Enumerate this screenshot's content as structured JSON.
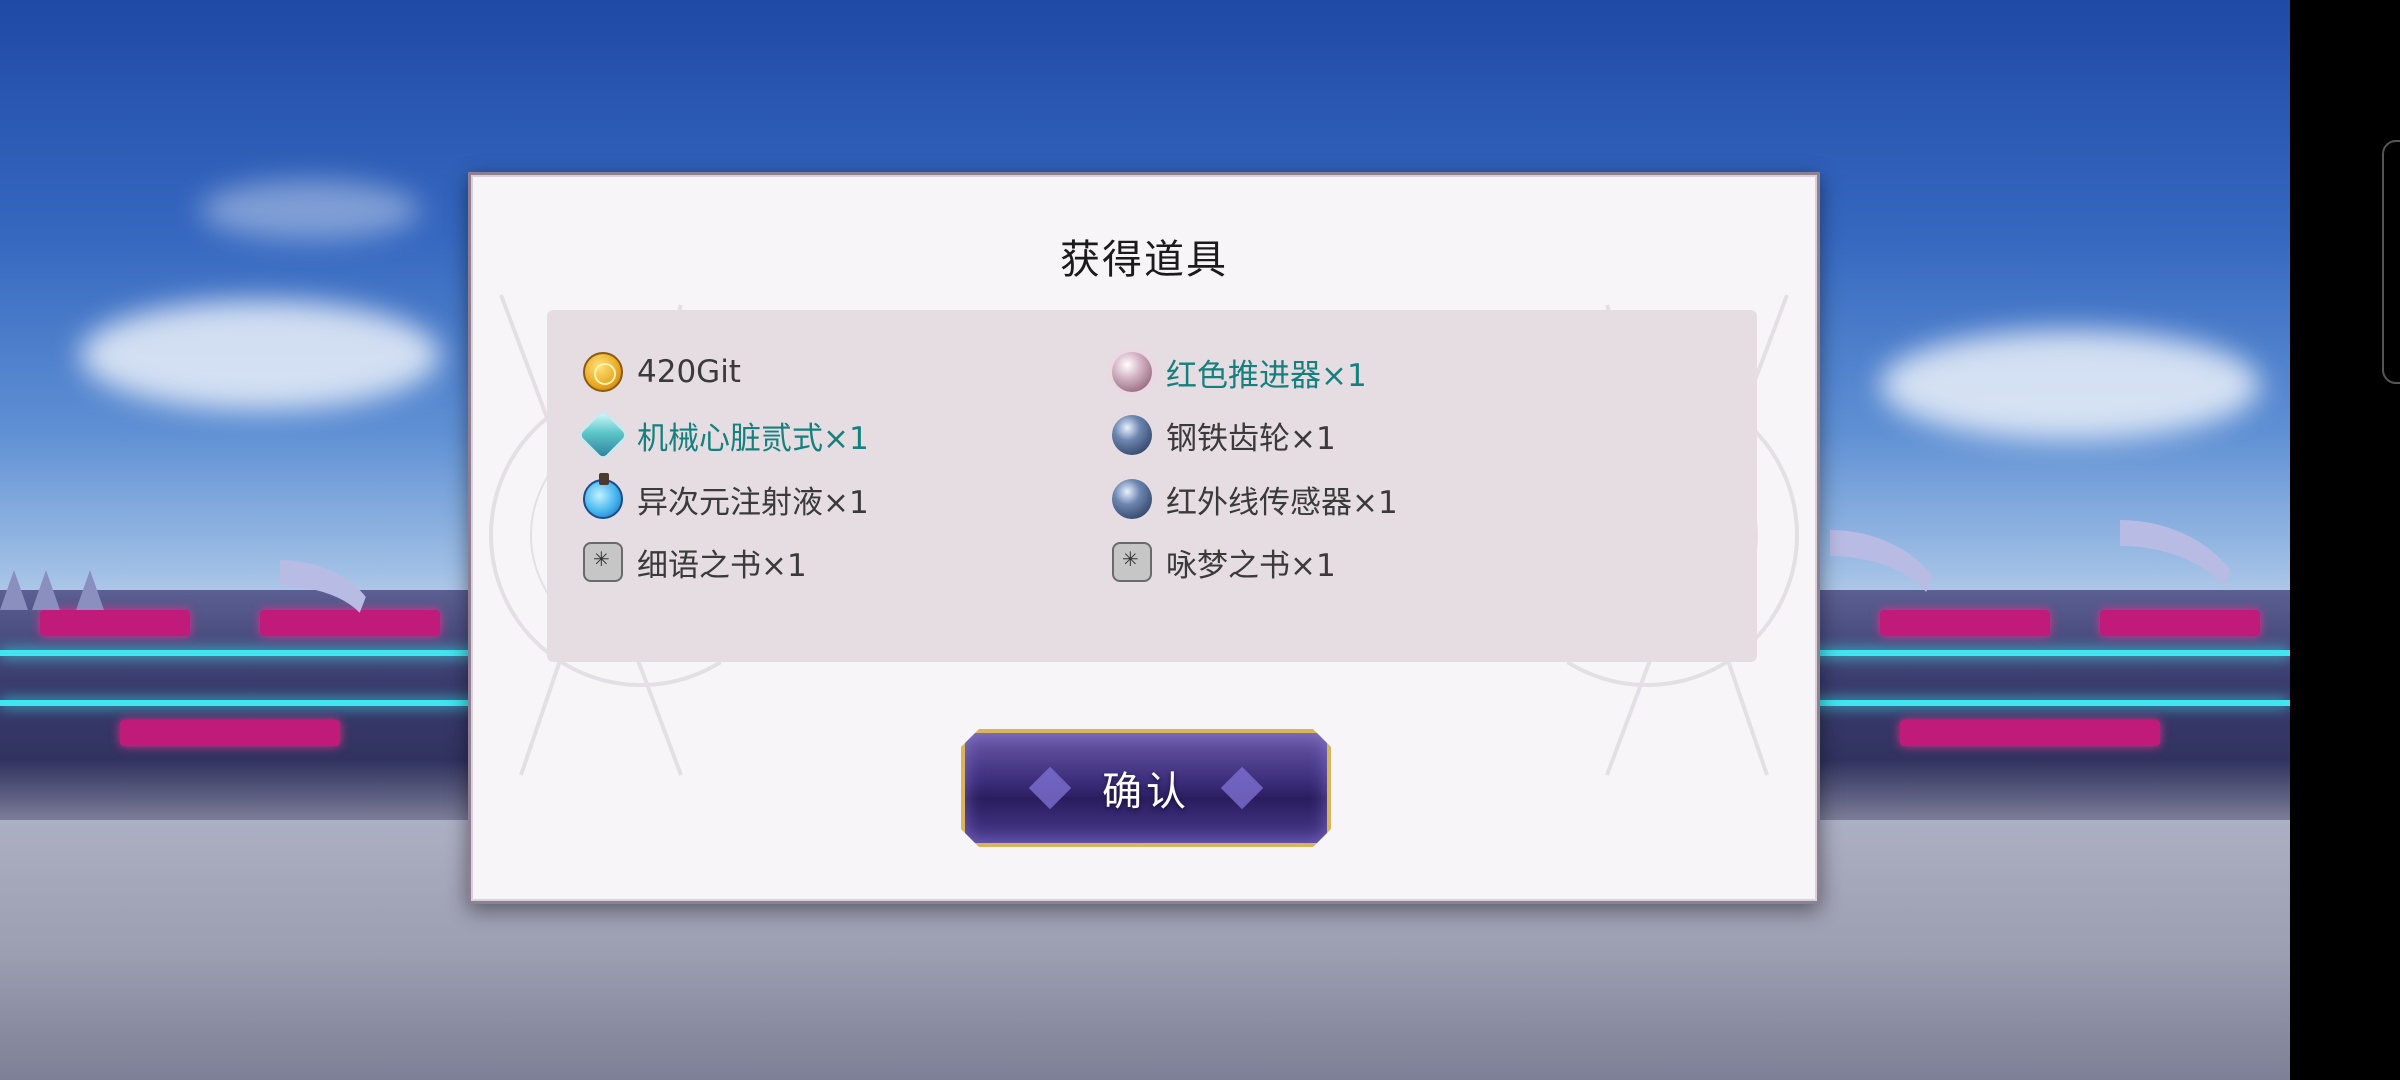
{
  "dialog": {
    "title": "获得道具",
    "items": [
      {
        "icon": "coin-icon",
        "label": "420Git",
        "rare": false
      },
      {
        "icon": "pearl-icon",
        "label": "红色推进器×1",
        "rare": true
      },
      {
        "icon": "crystal-icon",
        "label": "机械心脏贰式×1",
        "rare": true
      },
      {
        "icon": "orb-icon",
        "label": "钢铁齿轮×1",
        "rare": false
      },
      {
        "icon": "potion-icon",
        "label": "异次元注射液×1",
        "rare": false
      },
      {
        "icon": "orb-icon",
        "label": "红外线传感器×1",
        "rare": false
      },
      {
        "icon": "book-icon",
        "label": "细语之书×1",
        "rare": false
      },
      {
        "icon": "book-icon",
        "label": "咏梦之书×1",
        "rare": false
      }
    ],
    "confirm_label": "确认"
  },
  "colors": {
    "rare_text": "#15807d",
    "normal_text": "#3a3a3a",
    "panel_bg": "#e6dde3",
    "button_border": "#d8b45a"
  }
}
